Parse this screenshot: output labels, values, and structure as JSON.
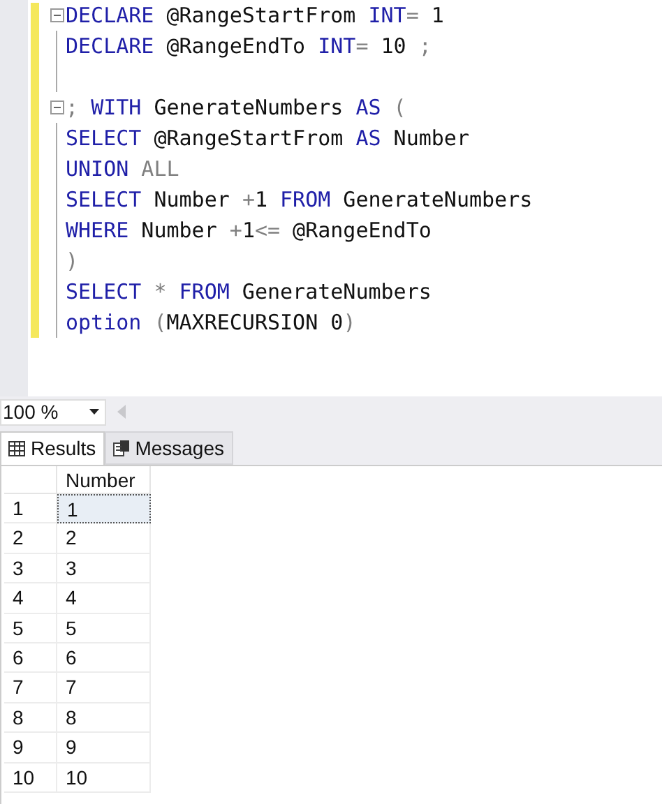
{
  "editor": {
    "lines": [
      {
        "collapsible": true,
        "tokens": [
          {
            "kind": "keyword",
            "t": "DECLARE"
          },
          {
            "kind": "text",
            "t": " @RangeStartFrom "
          },
          {
            "kind": "keyword",
            "t": "INT"
          },
          {
            "kind": "operator",
            "t": "="
          },
          {
            "kind": "text",
            "t": " 1"
          }
        ]
      },
      {
        "collapsible": false,
        "tokens": [
          {
            "kind": "keyword",
            "t": "DECLARE"
          },
          {
            "kind": "text",
            "t": " @RangeEndTo "
          },
          {
            "kind": "keyword",
            "t": "INT"
          },
          {
            "kind": "operator",
            "t": "="
          },
          {
            "kind": "text",
            "t": " 10 "
          },
          {
            "kind": "operator",
            "t": ";"
          }
        ]
      },
      {
        "collapsible": false
      },
      {
        "collapsible": true,
        "tokens": [
          {
            "kind": "operator",
            "t": "; "
          },
          {
            "kind": "keyword",
            "t": "WITH"
          },
          {
            "kind": "text",
            "t": " GenerateNumbers "
          },
          {
            "kind": "keyword",
            "t": "AS"
          },
          {
            "kind": "operator",
            "t": " ("
          }
        ]
      },
      {
        "collapsible": false,
        "tokens": [
          {
            "kind": "keyword",
            "t": "SELECT"
          },
          {
            "kind": "text",
            "t": " @RangeStartFrom "
          },
          {
            "kind": "keyword",
            "t": "AS"
          },
          {
            "kind": "text",
            "t": " Number"
          }
        ]
      },
      {
        "collapsible": false,
        "tokens": [
          {
            "kind": "keyword",
            "t": "UNION"
          },
          {
            "kind": "operator",
            "t": " ALL"
          }
        ]
      },
      {
        "collapsible": false,
        "tokens": [
          {
            "kind": "keyword",
            "t": "SELECT"
          },
          {
            "kind": "text",
            "t": " Number "
          },
          {
            "kind": "operator",
            "t": "+"
          },
          {
            "kind": "text",
            "t": "1 "
          },
          {
            "kind": "keyword",
            "t": "FROM"
          },
          {
            "kind": "text",
            "t": " GenerateNumbers"
          }
        ]
      },
      {
        "collapsible": false,
        "tokens": [
          {
            "kind": "keyword",
            "t": "WHERE"
          },
          {
            "kind": "text",
            "t": " Number "
          },
          {
            "kind": "operator",
            "t": "+"
          },
          {
            "kind": "text",
            "t": "1"
          },
          {
            "kind": "operator",
            "t": "<="
          },
          {
            "kind": "text",
            "t": " @RangeEndTo"
          }
        ]
      },
      {
        "collapsible": false,
        "tokens": [
          {
            "kind": "operator",
            "t": ")"
          }
        ]
      },
      {
        "collapsible": false,
        "tokens": [
          {
            "kind": "keyword",
            "t": "SELECT"
          },
          {
            "kind": "operator",
            "t": " * "
          },
          {
            "kind": "keyword",
            "t": "FROM"
          },
          {
            "kind": "text",
            "t": " GenerateNumbers"
          }
        ]
      },
      {
        "collapsible": false,
        "tokens": [
          {
            "kind": "keyword",
            "t": "option"
          },
          {
            "kind": "operator",
            "t": " ("
          },
          {
            "kind": "text",
            "t": "MAXRECURSION 0"
          },
          {
            "kind": "operator",
            "t": ")"
          }
        ]
      }
    ]
  },
  "zoom": {
    "value": "100 %"
  },
  "tabs": [
    {
      "label": "Results",
      "selected": true
    },
    {
      "label": "Messages",
      "selected": false
    }
  ],
  "grid": {
    "columns": [
      "Number"
    ],
    "rows": [
      {
        "row": "1",
        "number": "1",
        "selected": true
      },
      {
        "row": "2",
        "number": "2",
        "selected": false
      },
      {
        "row": "3",
        "number": "3",
        "selected": false
      },
      {
        "row": "4",
        "number": "4",
        "selected": false
      },
      {
        "row": "5",
        "number": "5",
        "selected": false
      },
      {
        "row": "6",
        "number": "6",
        "selected": false
      },
      {
        "row": "7",
        "number": "7",
        "selected": false
      },
      {
        "row": "8",
        "number": "8",
        "selected": false
      },
      {
        "row": "9",
        "number": "9",
        "selected": false
      },
      {
        "row": "10",
        "number": "10",
        "selected": false
      }
    ]
  }
}
